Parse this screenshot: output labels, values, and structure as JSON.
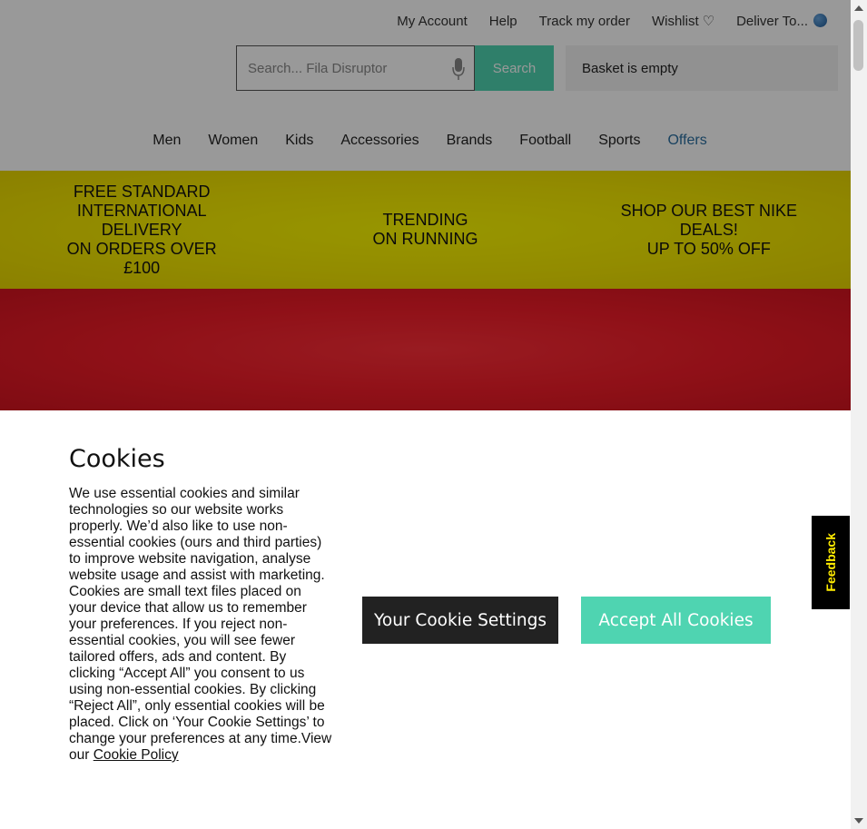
{
  "header": {
    "top_links": [
      "My Account",
      "Help",
      "Track my order",
      "Wishlist",
      "Deliver To..."
    ],
    "search_placeholder": "Search... Fila Disruptor",
    "search_button": "Search",
    "basket": "Basket is empty"
  },
  "nav": {
    "items": [
      "Men",
      "Women",
      "Kids",
      "Accessories",
      "Brands",
      "Football",
      "Sports",
      "Offers"
    ]
  },
  "promo": {
    "delivery_heading": "FREE STANDARD INTERNATIONAL DELIVERY",
    "delivery_sub": "ON ORDERS OVER £100",
    "trending_heading": "TRENDING",
    "trending_sub": "ON RUNNING",
    "nike_heading": "SHOP OUR BEST NIKE DEALS!",
    "nike_sub": "UP TO 50% OFF"
  },
  "cookie": {
    "title": "Cookies",
    "body": "We use essential cookies and similar technologies so our website works properly. We’d also like to use non-essential cookies (ours and third parties) to improve website navigation, analyse website usage and assist with marketing. Cookies are small text files placed on your device that allow us to remember your preferences. If you reject non-essential cookies, you will see fewer tailored offers, ads and content. By clicking “Accept All” you consent to us using non-essential cookies. By clicking “Reject All”, only essential cookies will be placed. Click on ‘Your Cookie Settings’ to change your preferences at any time.View our ",
    "policy_link": "Cookie Policy",
    "settings_button": "Your Cookie Settings",
    "accept_button": "Accept All Cookies"
  },
  "feedback": "Feedback",
  "colors": {
    "accent_teal": "#4fd4b1",
    "promo_yellow": "#f4e800",
    "hero_red": "#f01c28",
    "feedback_text": "#ffec00"
  }
}
